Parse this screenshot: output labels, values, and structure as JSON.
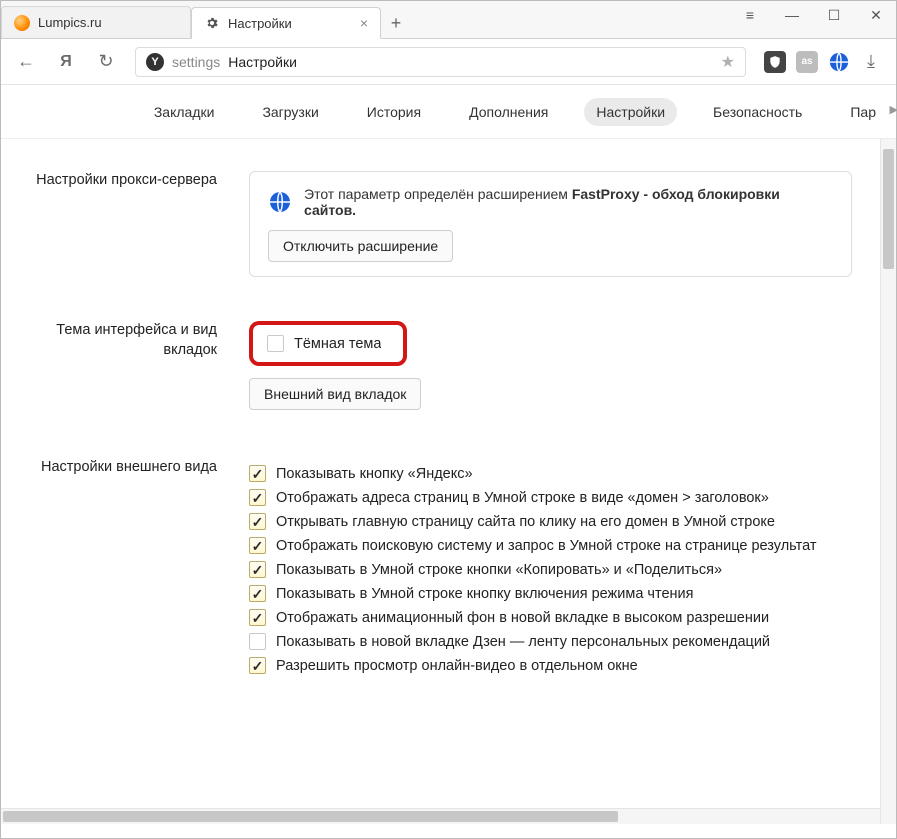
{
  "tabs": [
    {
      "title": "Lumpics.ru"
    },
    {
      "title": "Настройки"
    }
  ],
  "toolbar": {
    "back_glyph": "←",
    "yandex_glyph": "Я",
    "reload_glyph": "↻",
    "badge_glyph": "Y",
    "url_prefix": "settings",
    "url_title": "Настройки",
    "star_glyph": "★",
    "download_glyph": "⤓"
  },
  "window": {
    "menu": "≡",
    "min": "—",
    "max": "☐",
    "close": "✕"
  },
  "subnav": {
    "items": [
      "Закладки",
      "Загрузки",
      "История",
      "Дополнения",
      "Настройки",
      "Безопасность",
      "Пар"
    ],
    "active_index": 4
  },
  "sections": {
    "proxy": {
      "label": "Настройки прокси-сервера",
      "text_prefix": "Этот параметр определён расширением ",
      "ext_name": "FastProxy",
      "text_suffix": " - обход блокировки сайтов.",
      "disable_btn": "Отключить расширение"
    },
    "theme": {
      "label": "Тема интерфейса и вид вкладок",
      "dark_theme": "Тёмная тема",
      "tabs_btn": "Внешний вид вкладок"
    },
    "appearance": {
      "label": "Настройки внешнего вида",
      "items": [
        {
          "checked": true,
          "label": "Показывать кнопку «Яндекс»"
        },
        {
          "checked": true,
          "label": "Отображать адреса страниц в Умной строке в виде «домен > заголовок»"
        },
        {
          "checked": true,
          "label": "Открывать главную страницу сайта по клику на его домен в Умной строке"
        },
        {
          "checked": true,
          "label": "Отображать поисковую систему и запрос в Умной строке на странице результат"
        },
        {
          "checked": true,
          "label": "Показывать в Умной строке кнопки «Копировать» и «Поделиться»"
        },
        {
          "checked": true,
          "label": "Показывать в Умной строке кнопку включения режима чтения"
        },
        {
          "checked": true,
          "label": "Отображать анимационный фон в новой вкладке в высоком разрешении"
        },
        {
          "checked": false,
          "label": "Показывать в новой вкладке Дзен — ленту персональных рекомендаций"
        },
        {
          "checked": true,
          "label": "Разрешить просмотр онлайн-видео в отдельном окне"
        }
      ]
    }
  },
  "ext_labels": {
    "as": "as"
  }
}
